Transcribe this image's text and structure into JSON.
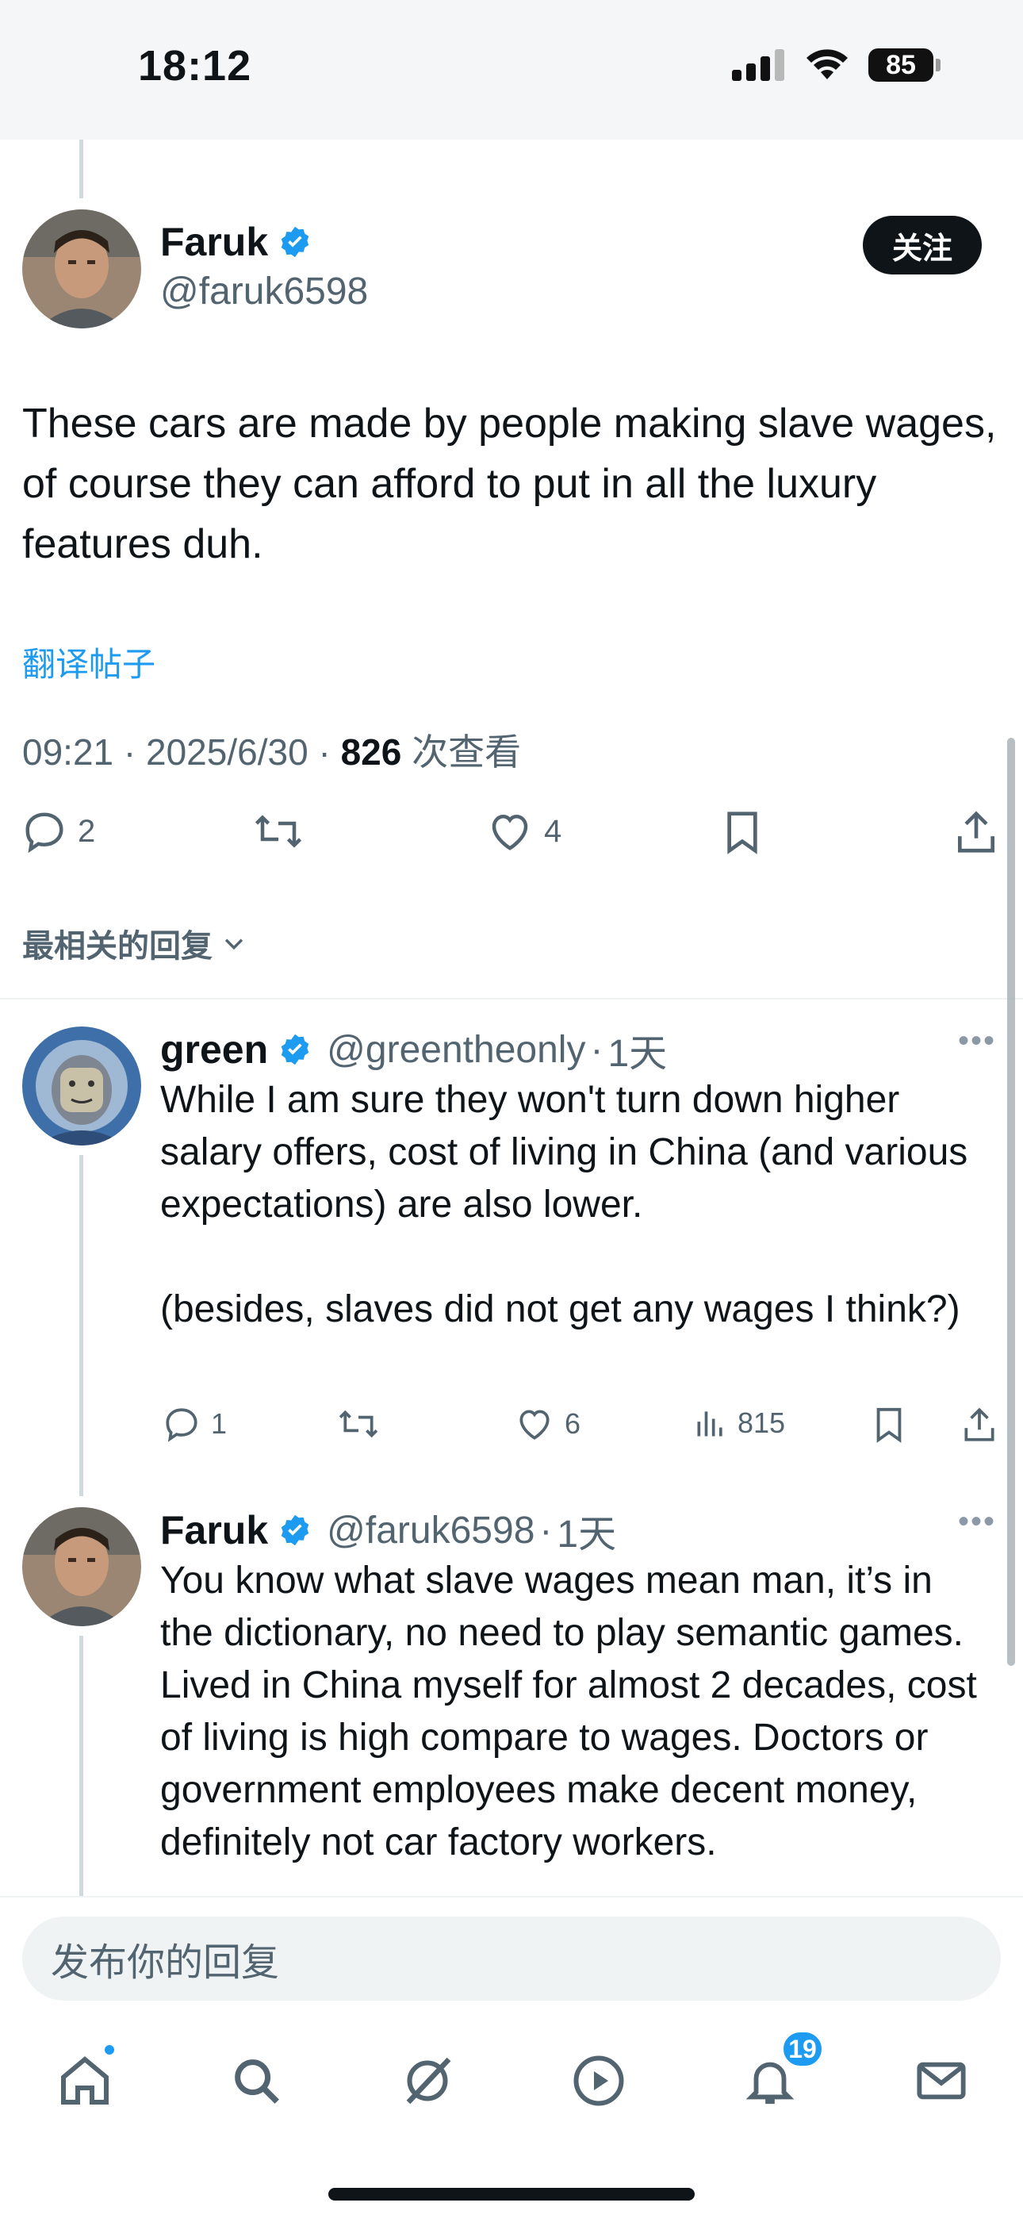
{
  "status_bar": {
    "time": "18:12",
    "battery": "85"
  },
  "main_post": {
    "author_name": "Faruk",
    "handle": "@faruk6598",
    "follow_label": "关注",
    "text": "These cars are made by people making slave wages, of course they can afford to put in all the luxury features duh.",
    "translate_label": "翻译帖子",
    "time": "09:21",
    "date": "2025/6/30",
    "views_count": "826",
    "views_label": "次查看",
    "replies": "2",
    "likes": "4"
  },
  "sort_label": "最相关的回复",
  "replies": [
    {
      "author_name": "green",
      "handle": "@greentheonly",
      "age": "1天",
      "text_p1": "While I am sure they won't turn down higher salary offers, cost of living in China (and various expectations) are also lower.",
      "text_p2": "(besides, slaves did not get any wages I think?)",
      "reply_count": "1",
      "like_count": "6",
      "view_count": "815"
    },
    {
      "author_name": "Faruk",
      "handle": "@faruk6598",
      "age": "1天",
      "text": "You know what slave wages mean man, it’s in the dictionary, no need to play semantic games. Lived in China myself for almost 2 decades, cost of living is high compare to wages. Doctors or government employees make decent money, definitely not car factory workers."
    }
  ],
  "compose": {
    "placeholder": "发布你的回复"
  },
  "nav": {
    "notifications_badge": "19"
  },
  "colors": {
    "accent": "#1d9bf0",
    "text": "#0f1419",
    "muted": "#536471"
  }
}
